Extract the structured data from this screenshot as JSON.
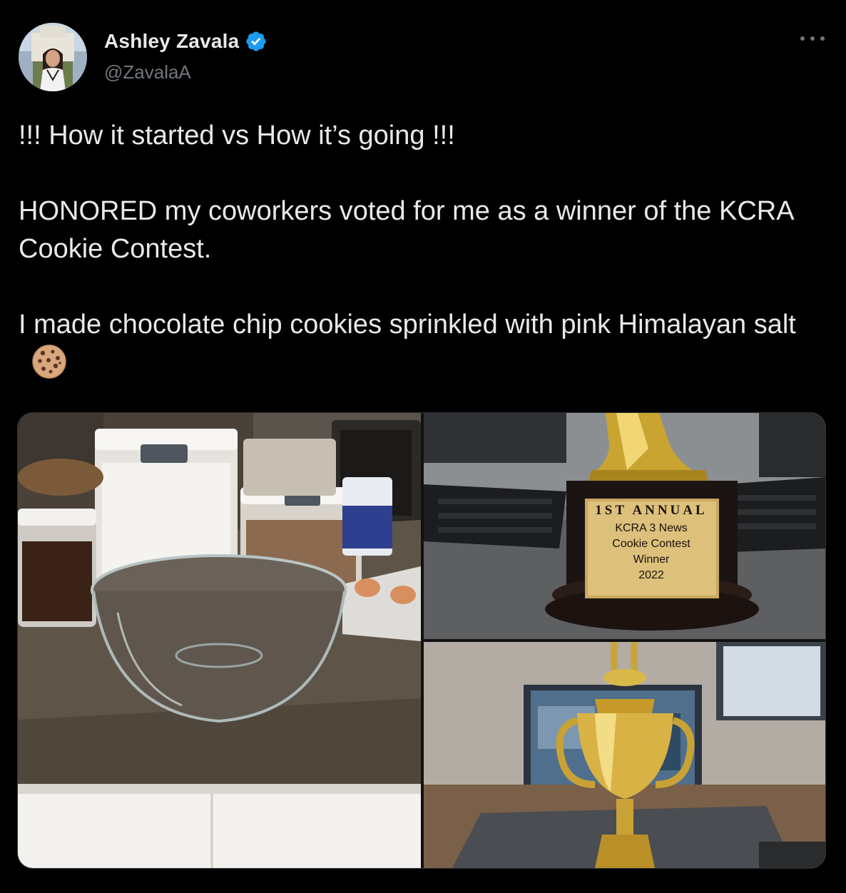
{
  "author": {
    "display_name": "Ashley Zavala",
    "handle": "@ZavalaA",
    "verified": true
  },
  "tweet": {
    "lines": [
      "!!! How it started vs How it’s going !!!",
      "HONORED my coworkers voted for me as a winner of the KCRA Cookie Contest.",
      "I made chocolate chip cookies sprinkled with pink Himalayan salt"
    ],
    "emoji": "cookie-icon"
  },
  "media": {
    "plaque": {
      "line1": "1ST ANNUAL",
      "line2": "KCRA 3 News",
      "line3": "Cookie Contest",
      "line4": "Winner",
      "line5": "2022"
    }
  },
  "colors": {
    "background": "#000000",
    "text": "#e7e9ea",
    "secondary": "#71767b",
    "verified": "#1d9bf0"
  }
}
